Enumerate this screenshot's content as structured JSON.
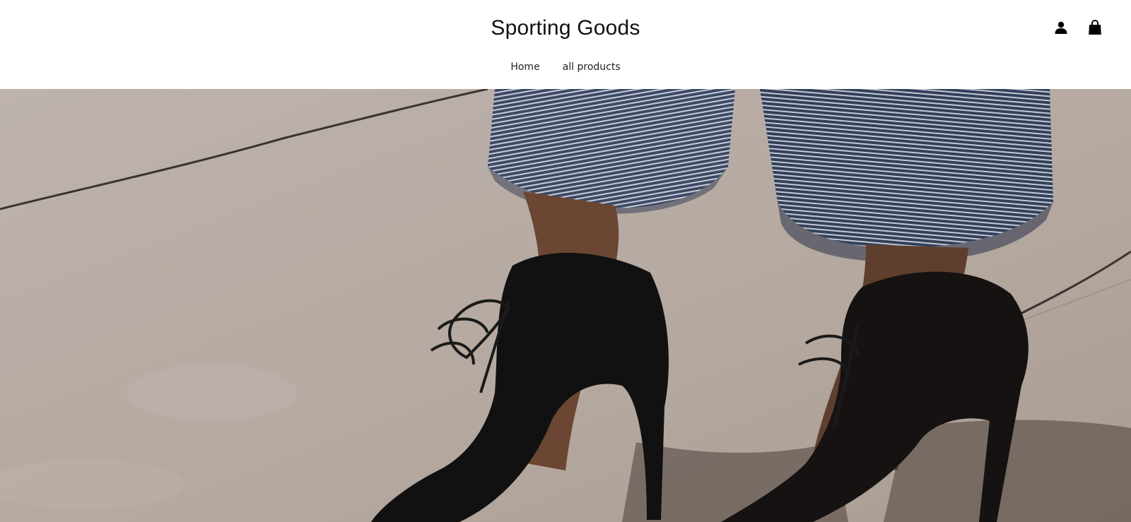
{
  "header": {
    "logo": "Sporting Goods",
    "nav": [
      {
        "label": "Home"
      },
      {
        "label": "all products"
      }
    ],
    "icons": [
      "account-icon",
      "shopping-bag-icon"
    ]
  },
  "hero": {
    "image_subject": "black lace-up high heels and cuffed striped jeans on pavement"
  },
  "colors": {
    "background": "#ffffff",
    "text": "#111111",
    "pavement": "#b9aea8"
  }
}
